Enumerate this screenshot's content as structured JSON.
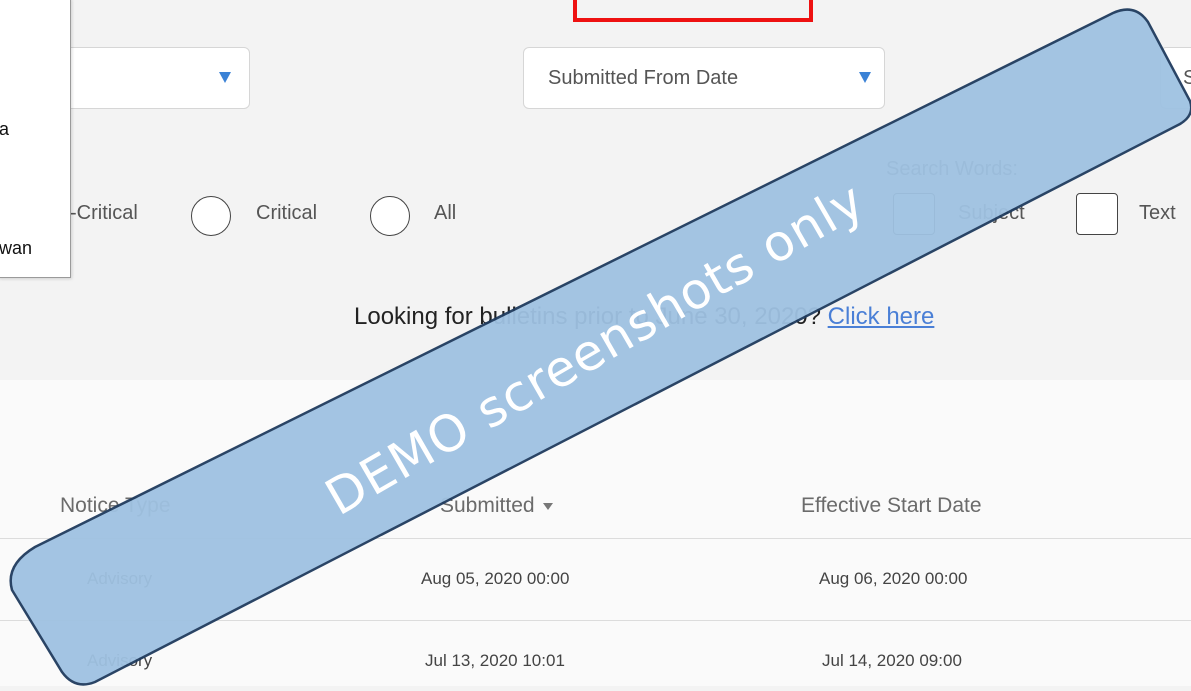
{
  "popup": {
    "items": [
      {
        "label": "a"
      },
      {
        "label": "wan"
      }
    ]
  },
  "filters": {
    "left_select_label": "",
    "submitted_from_label": "Submitted From Date",
    "right_select_label": "S",
    "priority_options": [
      {
        "label": "-Critical"
      },
      {
        "label": "Critical"
      },
      {
        "label": "All"
      }
    ],
    "search_words_label": "Search Words:",
    "search_word_options": [
      {
        "label": "Subject"
      },
      {
        "label": "Text"
      }
    ]
  },
  "notice": {
    "text": "Looking for bulletins prior to June 30, 2020?",
    "link_text": "Click here"
  },
  "table": {
    "columns": [
      {
        "label": "Notice Type"
      },
      {
        "label": "Submitted"
      },
      {
        "label": "Effective Start Date"
      }
    ],
    "rows": [
      {
        "notice_type": "Advisory",
        "submitted": "Aug 05, 2020 00:00",
        "effective_start": "Aug 06, 2020 00:00"
      },
      {
        "notice_type": "Advisory",
        "submitted": "Jul 13, 2020 10:01",
        "effective_start": "Jul 14, 2020 09:00"
      }
    ]
  },
  "watermark": {
    "text": "DEMO screenshots only",
    "fill_color": "#9fc2e2",
    "stroke_color": "#1f3b5e"
  },
  "colors": {
    "accent_blue": "#3b82d6",
    "link_blue": "#4a7fd6",
    "highlight_red": "#ee1111"
  }
}
